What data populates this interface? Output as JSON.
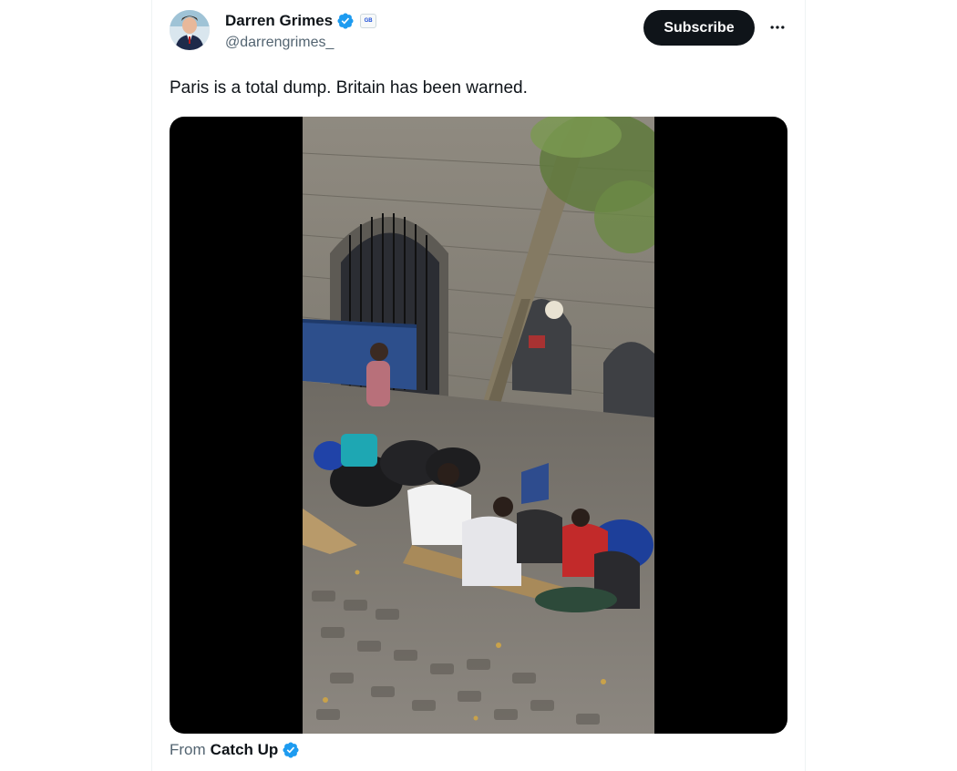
{
  "author": {
    "name": "Darren Grimes",
    "handle": "@darrengrimes_",
    "affiliation_badge": "GB",
    "verified_color": "#1d9bf0"
  },
  "actions": {
    "subscribe_label": "Subscribe",
    "more_icon": "more-horizontal-icon"
  },
  "tweet": {
    "text": "Paris is a total dump. Britain has been warned."
  },
  "media": {
    "type": "video",
    "description_icon": "video-thumbnail"
  },
  "source": {
    "prefix": "From",
    "name": "Catch Up"
  },
  "colors": {
    "subscribe_bg": "#0f1419",
    "secondary_text": "#536471",
    "verified": "#1d9bf0"
  }
}
